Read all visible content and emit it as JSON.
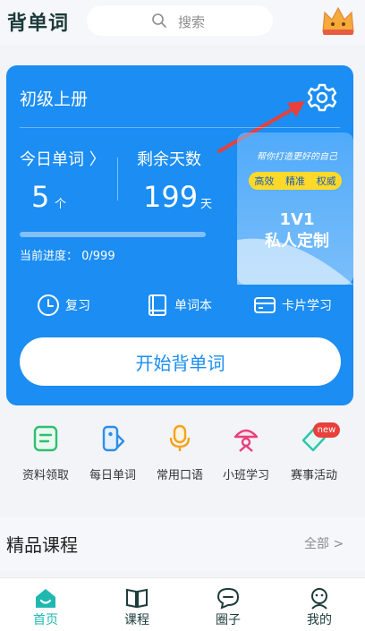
{
  "header": {
    "app_title": "背单词",
    "search_placeholder": "搜索"
  },
  "card": {
    "book_title": "初级上册",
    "today_label": "今日单词 〉",
    "today_count": "5",
    "today_unit": "个",
    "remain_label": "剩余天数",
    "remain_count": "199",
    "remain_unit": "天",
    "progress_label": "当前进度：  0/999",
    "progress_fraction": 0,
    "promo": {
      "slogan": "帮你打造更好的自己",
      "tags": [
        "高效",
        "精准",
        "权威"
      ],
      "line1": "1V1",
      "line2": "私人定制"
    },
    "tools": [
      {
        "label": "复习",
        "icon": "clock-icon"
      },
      {
        "label": "单词本",
        "icon": "book-icon"
      },
      {
        "label": "卡片学习",
        "icon": "card-icon"
      }
    ],
    "start_button": "开始背单词"
  },
  "shortcuts": [
    {
      "label": "资料领取",
      "icon": "document-icon",
      "color": "#2fbf71"
    },
    {
      "label": "每日单词",
      "icon": "phone-icon",
      "color": "#2f8de8"
    },
    {
      "label": "常用口语",
      "icon": "microphone-icon",
      "color": "#f5a31a"
    },
    {
      "label": "小班学习",
      "icon": "lamp-icon",
      "color": "#e8407a"
    },
    {
      "label": "赛事活动",
      "icon": "tag-icon",
      "color": "#2dc6a8",
      "badge": "new"
    }
  ],
  "courses": {
    "title": "精品课程",
    "more": "全部 >"
  },
  "tabbar": [
    {
      "label": "首页",
      "icon": "home-icon",
      "active": true
    },
    {
      "label": "课程",
      "icon": "open-book-icon",
      "active": false
    },
    {
      "label": "圈子",
      "icon": "chat-icon",
      "active": false
    },
    {
      "label": "我的",
      "icon": "profile-icon",
      "active": false
    }
  ],
  "colors": {
    "accent": "#1b8df3",
    "tab_active": "#1fb8b0",
    "tab_inactive": "#1d3b3b"
  }
}
